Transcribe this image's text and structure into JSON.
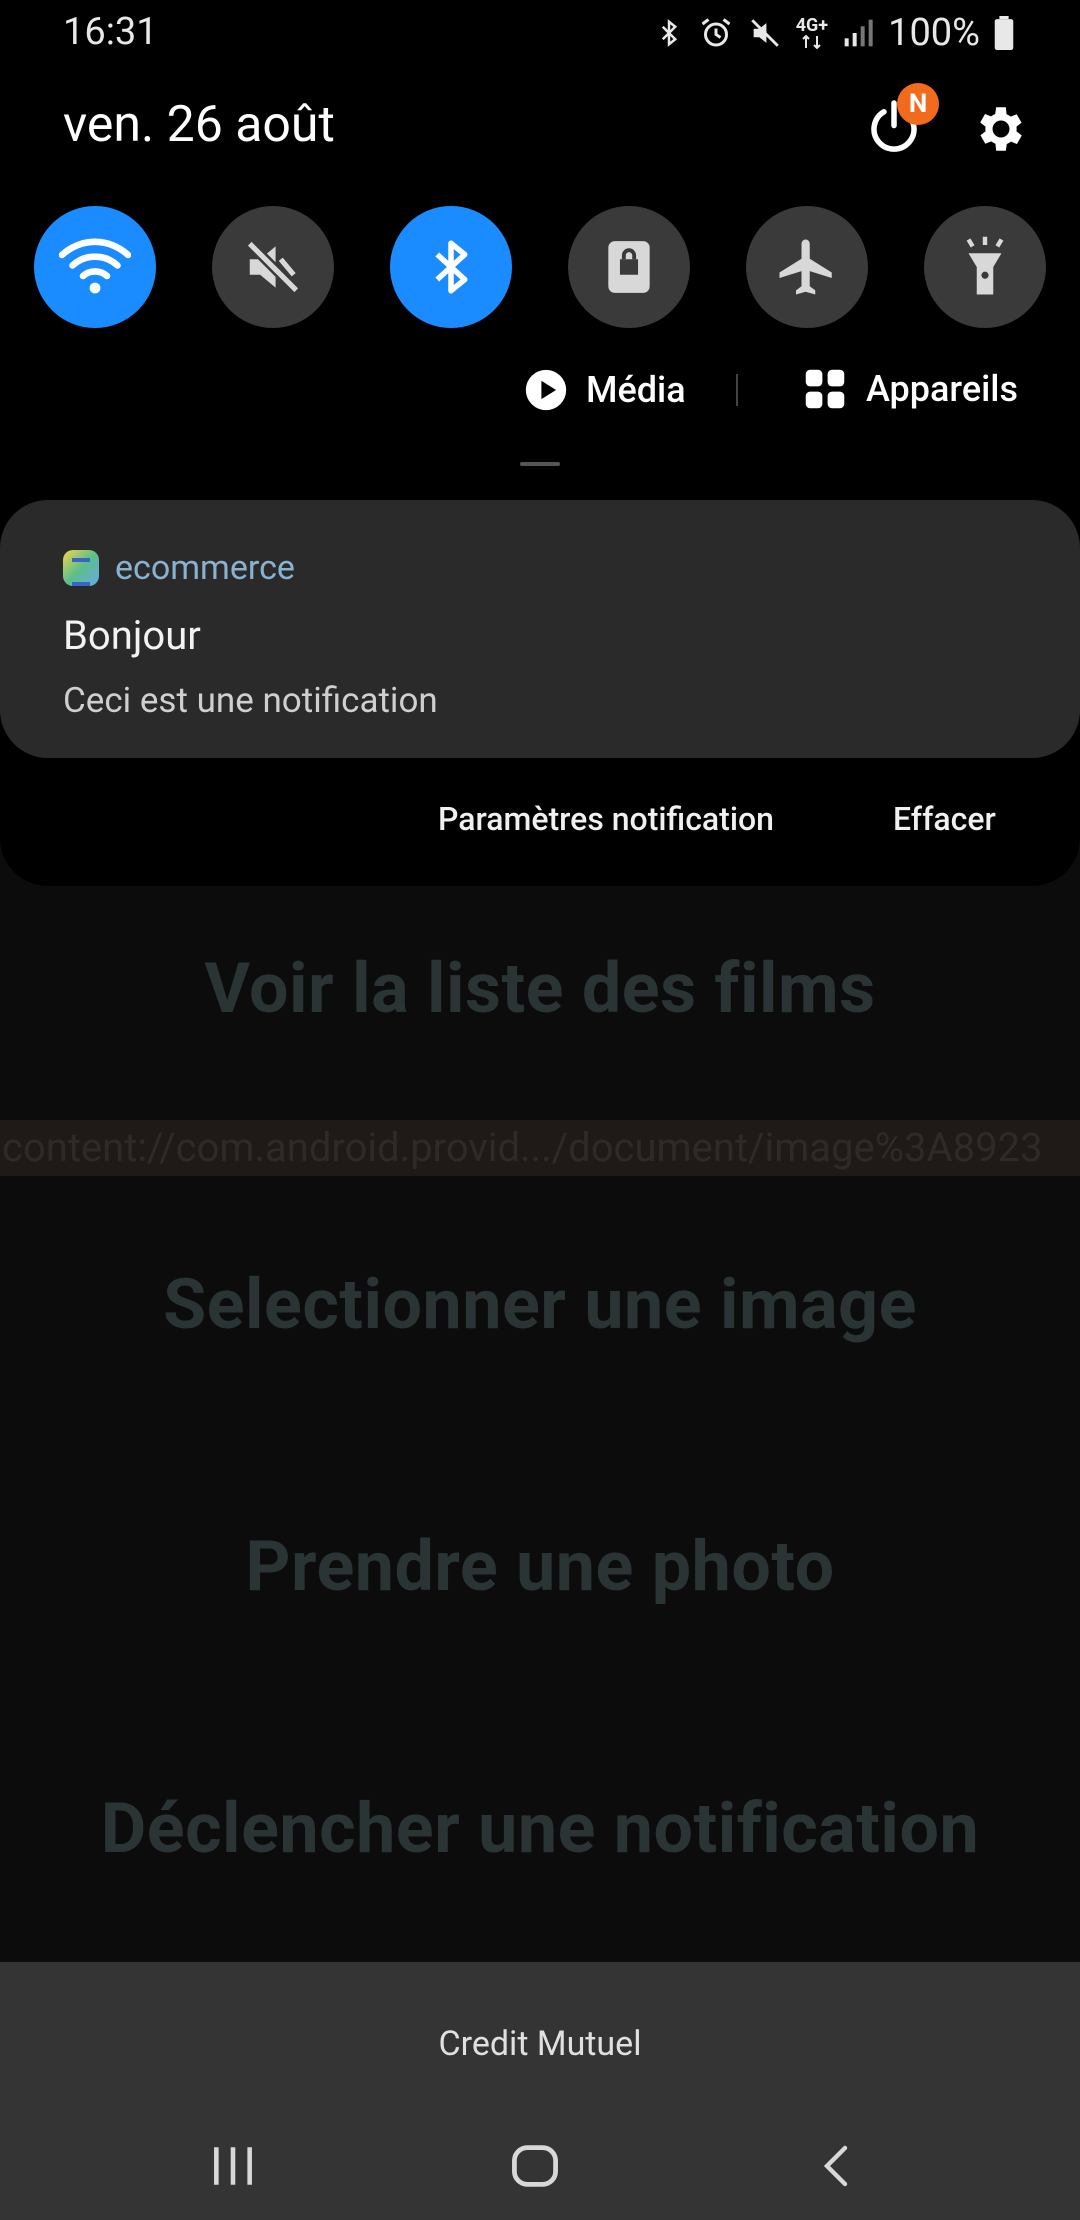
{
  "status_bar": {
    "time": "16:31",
    "network": "4G+",
    "battery": "100%"
  },
  "header": {
    "date": "ven. 26 août",
    "power_badge": "N"
  },
  "quick_settings": [
    {
      "name": "wifi",
      "on": true
    },
    {
      "name": "mute",
      "on": false
    },
    {
      "name": "bluetooth",
      "on": true
    },
    {
      "name": "screen-lock",
      "on": false
    },
    {
      "name": "airplane",
      "on": false
    },
    {
      "name": "flashlight",
      "on": false
    }
  ],
  "media_row": {
    "media_label": "Média",
    "devices_label": "Appareils"
  },
  "notification": {
    "app_name": "ecommerce",
    "title": "Bonjour",
    "text": "Ceci est une notification",
    "settings_action": "Paramètres notification",
    "clear_action": "Effacer"
  },
  "background_app": {
    "films_button": "Voir la liste des films",
    "uri_text": "content://com.android.provid.../document/image%3A8923",
    "select_image_button": "Selectionner une image",
    "take_photo_button": "Prendre une photo",
    "trigger_notification_button": "Déclencher une notification"
  },
  "toast": {
    "text": "Credit Mutuel"
  },
  "colors": {
    "accent": "#1a8cff",
    "badge": "#f26a1b",
    "app_name": "#88b2cf"
  }
}
